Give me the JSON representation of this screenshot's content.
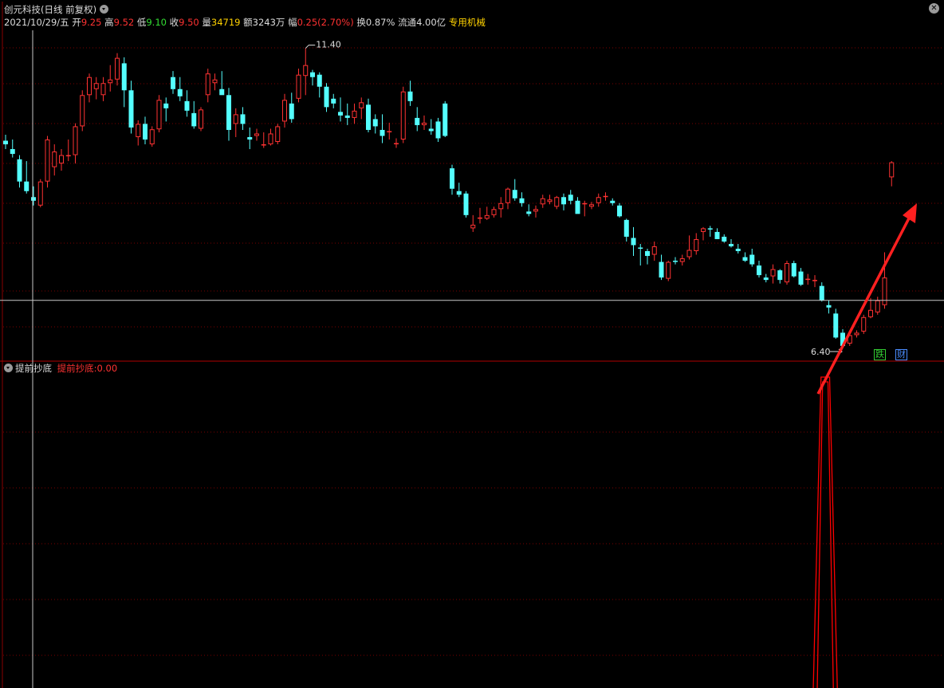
{
  "header": {
    "stock_title": "创元科技(日线 前复权)",
    "date": "2021/10/29/五",
    "open_label": "开",
    "open": "9.25",
    "high_label": "高",
    "high": "9.52",
    "low_label": "低",
    "low": "9.10",
    "close_label": "收",
    "close": "9.50",
    "volume_label": "量",
    "volume": "34719",
    "amount_label": "额",
    "amount": "3243万",
    "change_label": "幅",
    "change": "0.25(2.70%)",
    "turnover_label": "换",
    "turnover": "0.87%",
    "float_label": "流通",
    "float": "4.00亿",
    "sector": "专用机械"
  },
  "indicator": {
    "name": "提前抄底",
    "label": "提前抄底:",
    "value": "0.00"
  },
  "annotations": {
    "max_price": "11.40",
    "min_price": "6.40",
    "tag_fall": "跌",
    "tag_finance": "财"
  },
  "colors": {
    "up": "#ff3232",
    "down": "#54ffff",
    "grid": "#7a0000",
    "indicator_line": "#ff0000",
    "arrow": "#ff2020",
    "tag_fall": "#33cc33",
    "tag_finance": "#4a8cff"
  },
  "chart_data": [
    {
      "type": "candlestick",
      "title": "创元科技(日线 前复权)",
      "ylim": [
        6.2,
        11.7
      ],
      "crosshair_price": 7.2,
      "candles": [
        [
          9.86,
          9.96,
          9.72,
          9.8
        ],
        [
          9.72,
          9.88,
          9.58,
          9.64
        ],
        [
          9.55,
          9.62,
          9.08,
          9.18
        ],
        [
          9.18,
          9.52,
          8.98,
          9.02
        ],
        [
          8.92,
          9.1,
          8.78,
          8.86
        ],
        [
          8.78,
          9.22,
          8.75,
          9.18
        ],
        [
          9.18,
          9.94,
          9.08,
          9.88
        ],
        [
          9.42,
          9.8,
          9.28,
          9.68
        ],
        [
          9.48,
          9.72,
          9.36,
          9.62
        ],
        [
          9.62,
          9.88,
          9.52,
          9.62
        ],
        [
          9.62,
          10.15,
          9.48,
          10.1
        ],
        [
          10.1,
          10.7,
          10.02,
          10.62
        ],
        [
          10.62,
          10.98,
          10.5,
          10.92
        ],
        [
          10.72,
          10.92,
          10.55,
          10.82
        ],
        [
          10.62,
          10.92,
          10.52,
          10.82
        ],
        [
          10.82,
          11.12,
          10.68,
          10.88
        ],
        [
          10.88,
          11.32,
          10.78,
          11.24
        ],
        [
          11.15,
          11.25,
          10.42,
          10.7
        ],
        [
          10.7,
          10.86,
          9.98,
          10.08
        ],
        [
          9.92,
          10.2,
          9.78,
          10.14
        ],
        [
          10.14,
          10.26,
          9.8,
          9.88
        ],
        [
          9.8,
          10.1,
          9.76,
          10.05
        ],
        [
          10.05,
          10.62,
          10.0,
          10.54
        ],
        [
          10.48,
          10.58,
          10.18,
          10.4
        ],
        [
          10.92,
          11.02,
          10.64,
          10.72
        ],
        [
          10.72,
          10.92,
          10.52,
          10.6
        ],
        [
          10.52,
          10.7,
          10.26,
          10.36
        ],
        [
          10.32,
          10.52,
          10.06,
          10.1
        ],
        [
          10.06,
          10.42,
          10.02,
          10.38
        ],
        [
          10.62,
          11.06,
          10.5,
          10.98
        ],
        [
          10.82,
          10.98,
          10.7,
          10.88
        ],
        [
          10.72,
          11.02,
          10.64,
          10.62
        ],
        [
          10.62,
          10.74,
          9.86,
          10.04
        ],
        [
          10.14,
          10.4,
          9.92,
          10.3
        ],
        [
          10.3,
          10.42,
          10.04,
          10.14
        ],
        [
          9.92,
          10.08,
          9.72,
          9.88
        ],
        [
          9.94,
          10.06,
          9.86,
          9.98
        ],
        [
          9.8,
          10.0,
          9.74,
          9.8
        ],
        [
          9.8,
          10.06,
          9.78,
          9.98
        ],
        [
          9.84,
          10.14,
          9.8,
          10.1
        ],
        [
          10.18,
          10.64,
          10.08,
          10.54
        ],
        [
          10.48,
          10.66,
          10.16,
          10.22
        ],
        [
          10.56,
          11.06,
          10.5,
          10.96
        ],
        [
          10.94,
          11.4,
          10.62,
          11.12
        ],
        [
          11.0,
          11.04,
          10.78,
          10.92
        ],
        [
          10.96,
          11.0,
          10.58,
          10.76
        ],
        [
          10.76,
          10.82,
          10.34,
          10.42
        ],
        [
          10.56,
          10.64,
          10.4,
          10.48
        ],
        [
          10.34,
          10.58,
          10.18,
          10.28
        ],
        [
          10.28,
          10.48,
          10.12,
          10.24
        ],
        [
          10.24,
          10.48,
          10.14,
          10.36
        ],
        [
          10.4,
          10.58,
          10.22,
          10.5
        ],
        [
          10.46,
          10.56,
          10.0,
          10.04
        ],
        [
          10.22,
          10.3,
          9.98,
          10.1
        ],
        [
          10.04,
          10.3,
          9.82,
          9.94
        ],
        [
          10.0,
          10.16,
          9.88,
          10.02
        ],
        [
          9.82,
          9.9,
          9.74,
          9.82
        ],
        [
          9.88,
          10.76,
          9.82,
          10.68
        ],
        [
          10.68,
          10.86,
          10.44,
          10.52
        ],
        [
          10.24,
          10.42,
          10.02,
          10.12
        ],
        [
          10.12,
          10.28,
          10.04,
          10.16
        ],
        [
          10.06,
          10.22,
          9.96,
          10.02
        ],
        [
          10.18,
          10.24,
          9.84,
          9.9
        ],
        [
          10.48,
          10.52,
          9.92,
          9.94
        ],
        [
          9.4,
          9.46,
          8.96,
          9.06
        ],
        [
          9.02,
          9.16,
          8.92,
          8.96
        ],
        [
          8.98,
          9.02,
          8.58,
          8.62
        ],
        [
          8.4,
          8.62,
          8.34,
          8.46
        ],
        [
          8.58,
          8.74,
          8.48,
          8.58
        ],
        [
          8.56,
          8.76,
          8.54,
          8.62
        ],
        [
          8.62,
          8.76,
          8.58,
          8.72
        ],
        [
          8.72,
          8.92,
          8.58,
          8.82
        ],
        [
          8.82,
          9.08,
          8.72,
          9.06
        ],
        [
          9.04,
          9.22,
          8.86,
          8.9
        ],
        [
          8.9,
          9.0,
          8.76,
          8.82
        ],
        [
          8.68,
          8.8,
          8.6,
          8.64
        ],
        [
          8.68,
          8.78,
          8.58,
          8.72
        ],
        [
          8.8,
          8.96,
          8.74,
          8.9
        ],
        [
          8.84,
          8.96,
          8.8,
          8.88
        ],
        [
          8.76,
          8.94,
          8.72,
          8.92
        ],
        [
          8.92,
          8.98,
          8.7,
          8.8
        ],
        [
          8.96,
          9.04,
          8.8,
          8.86
        ],
        [
          8.86,
          8.92,
          8.66,
          8.64
        ],
        [
          8.82,
          8.86,
          8.6,
          8.82
        ],
        [
          8.76,
          8.84,
          8.72,
          8.8
        ],
        [
          8.82,
          8.98,
          8.76,
          8.92
        ],
        [
          8.92,
          9.0,
          8.86,
          8.94
        ],
        [
          8.86,
          8.9,
          8.78,
          8.82
        ],
        [
          8.78,
          8.82,
          8.58,
          8.6
        ],
        [
          8.54,
          8.56,
          8.18,
          8.26
        ],
        [
          8.24,
          8.42,
          7.94,
          8.12
        ],
        [
          8.08,
          8.14,
          7.78,
          8.06
        ],
        [
          8.02,
          8.06,
          7.8,
          7.94
        ],
        [
          7.96,
          8.18,
          7.86,
          8.1
        ],
        [
          7.84,
          7.96,
          7.54,
          7.58
        ],
        [
          7.56,
          7.86,
          7.52,
          7.84
        ],
        [
          7.86,
          7.92,
          7.8,
          7.84
        ],
        [
          7.84,
          7.96,
          7.78,
          7.9
        ],
        [
          7.92,
          8.28,
          7.88,
          8.04
        ],
        [
          8.02,
          8.32,
          7.96,
          8.22
        ],
        [
          8.34,
          8.42,
          8.2,
          8.4
        ],
        [
          8.4,
          8.44,
          8.26,
          8.38
        ],
        [
          8.34,
          8.4,
          8.22,
          8.22
        ],
        [
          8.26,
          8.3,
          8.16,
          8.18
        ],
        [
          8.14,
          8.22,
          8.08,
          8.1
        ],
        [
          8.06,
          8.14,
          7.98,
          8.02
        ],
        [
          7.92,
          8.0,
          7.84,
          7.86
        ],
        [
          7.96,
          8.06,
          7.76,
          7.8
        ],
        [
          7.78,
          7.86,
          7.58,
          7.62
        ],
        [
          7.58,
          7.64,
          7.5,
          7.54
        ],
        [
          7.6,
          7.8,
          7.48,
          7.72
        ],
        [
          7.7,
          7.72,
          7.48,
          7.54
        ],
        [
          7.5,
          7.86,
          7.46,
          7.82
        ],
        [
          7.82,
          7.86,
          7.58,
          7.6
        ],
        [
          7.68,
          7.74,
          7.44,
          7.46
        ],
        [
          7.56,
          7.64,
          7.46,
          7.56
        ],
        [
          7.52,
          7.62,
          7.42,
          7.54
        ],
        [
          7.44,
          7.5,
          7.18,
          7.2
        ],
        [
          7.12,
          7.2,
          6.98,
          7.08
        ],
        [
          6.98,
          7.06,
          6.56,
          6.58
        ],
        [
          6.66,
          6.72,
          6.4,
          6.44
        ],
        [
          6.48,
          6.68,
          6.44,
          6.62
        ],
        [
          6.62,
          6.7,
          6.58,
          6.66
        ],
        [
          6.68,
          6.96,
          6.64,
          6.92
        ],
        [
          6.92,
          7.24,
          6.9,
          7.04
        ],
        [
          7.0,
          7.26,
          6.96,
          7.2
        ],
        [
          7.12,
          8.0,
          7.06,
          7.58
        ],
        [
          9.25,
          9.52,
          9.1,
          9.5
        ]
      ]
    },
    {
      "type": "line",
      "title": "提前抄底",
      "ylim": [
        0,
        1
      ],
      "spike": {
        "series": "提前抄底",
        "start_index": 116,
        "end_index": 119,
        "value": 1.0
      }
    }
  ]
}
